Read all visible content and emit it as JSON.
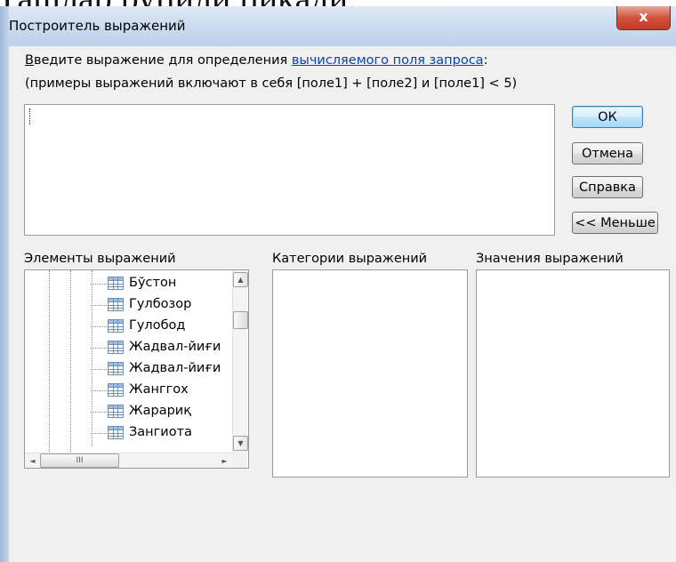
{
  "background_text": "Ташлар рупили пиқади.",
  "window": {
    "title": "Построитель выражений",
    "close_glyph": "x"
  },
  "instructions": {
    "line1_accel": "В",
    "line1_prefix": "ведите выражение для определения ",
    "line1_link": "вычисляемого поля запроса",
    "line1_suffix": ":",
    "line2": "(примеры выражений включают в себя [поле1] + [поле2] и [поле1] < 5)"
  },
  "expression": {
    "value": ""
  },
  "buttons": {
    "ok": "ОК",
    "cancel": "Отмена",
    "help": "Справка",
    "less": "<< Меньше"
  },
  "sections": {
    "elements": "Элементы выражений",
    "categories": "Категории выражений",
    "values": "Значения выражений"
  },
  "tree_items": [
    "Бўстон",
    "Гулбозор",
    "Гулобод",
    "Жадвал-йиғи",
    "Жадвал-йиғи",
    "Жанггох",
    "Жарариқ",
    "Зангиота"
  ],
  "icons": {
    "table": "table-icon",
    "scroll_up": "▲",
    "scroll_down": "▼",
    "scroll_left": "◄",
    "scroll_right": "►",
    "thumb_grip": "III"
  },
  "colors": {
    "link": "#0645ad",
    "close_button": "#c13a24",
    "dialog_bg": "#f0f0f0",
    "titlebar": "#c9dbef"
  }
}
